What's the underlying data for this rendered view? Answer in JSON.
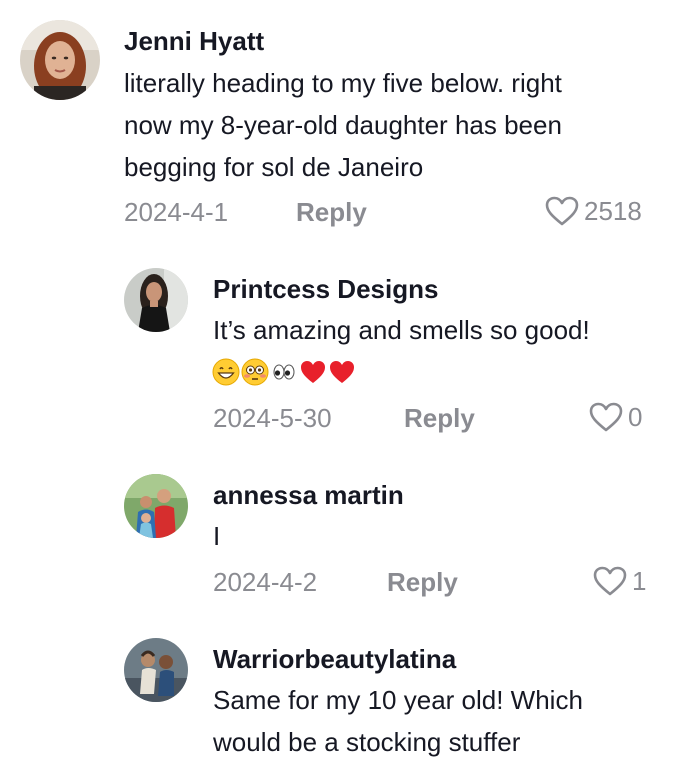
{
  "comments": [
    {
      "author": "Jenni Hyatt",
      "lines": [
        "literally heading to my five below. right",
        "now my 8-year-old daughter has been",
        "begging for sol de Janeiro"
      ],
      "date": "2024-4-1",
      "reply_label": "Reply",
      "likes": "2518"
    },
    {
      "author": "Printcess Designs",
      "lines": [
        "It’s amazing and smells so good!"
      ],
      "emojis": [
        "grinning-face",
        "flushed-face",
        "eyes",
        "red-heart",
        "red-heart"
      ],
      "date": "2024-5-30",
      "reply_label": "Reply",
      "likes": "0"
    },
    {
      "author": "annessa martin",
      "lines": [
        "I"
      ],
      "date": "2024-4-2",
      "reply_label": "Reply",
      "likes": "1"
    },
    {
      "author": "Warriorbeautylatina",
      "lines": [
        "Same for my 10 year old! Which",
        "would be a stocking stuffer"
      ]
    }
  ],
  "colors": {
    "text": "#161823",
    "meta": "#8a8b91",
    "heart_red": "#e8202b"
  }
}
